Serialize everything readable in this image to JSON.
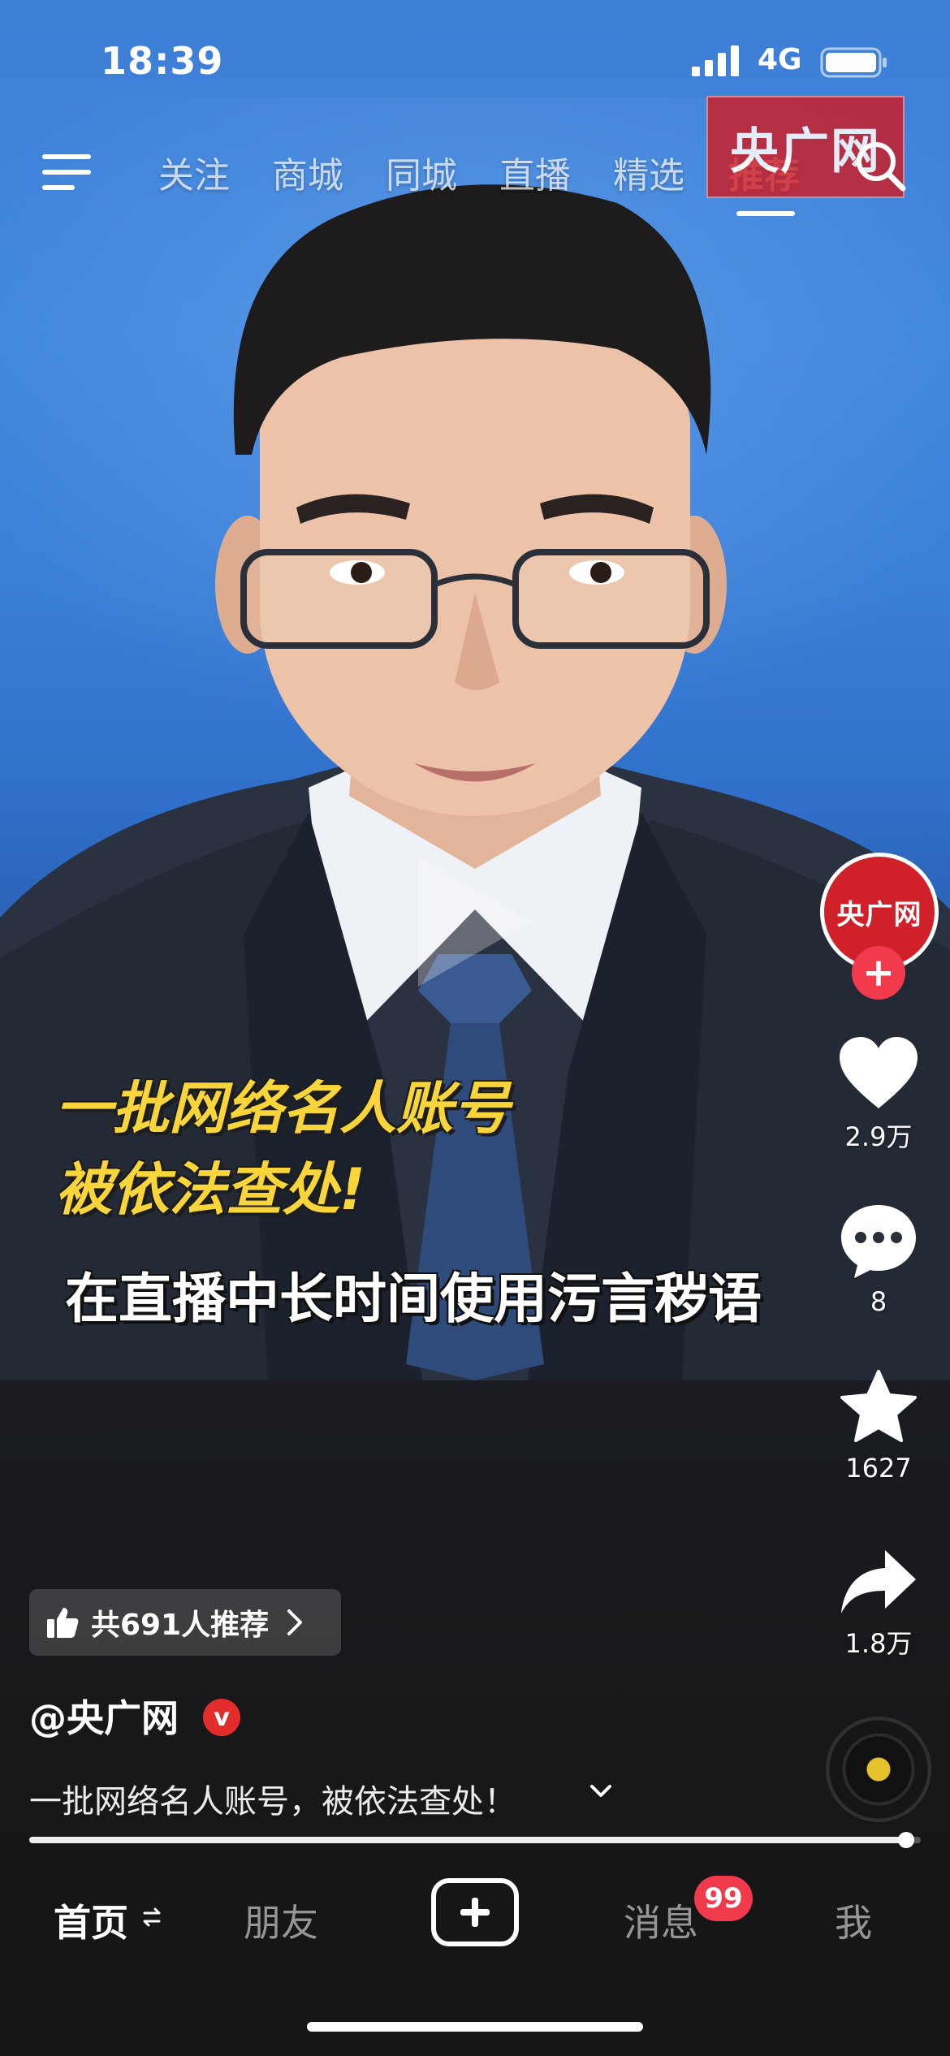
{
  "status_bar": {
    "time": "18:39",
    "network": "4G",
    "icons": [
      "signal-icon",
      "battery-icon"
    ]
  },
  "top_nav": {
    "tabs": [
      {
        "label": "关注"
      },
      {
        "label": "商城"
      },
      {
        "label": "同城"
      },
      {
        "label": "直播"
      },
      {
        "label": "精选"
      },
      {
        "label": "推荐",
        "active": true
      }
    ],
    "icons": [
      "menu-icon",
      "search-icon"
    ]
  },
  "video": {
    "watermark": "央广网",
    "caption_headline": [
      "一批网络名人账号",
      "被依法查处!"
    ],
    "caption_subtitle": "在直播中长时间使用污言秽语"
  },
  "right_rail": {
    "avatar_text": "央广网",
    "follow": "+",
    "likes": "2.9万",
    "comments": "8",
    "favorites": "1627",
    "shares": "1.8万"
  },
  "info": {
    "recommend": "共691人推荐",
    "author": "@央广网",
    "verified": "v",
    "description": "一批网络名人账号，被依法查处！"
  },
  "progress": {
    "fraction": 0.984
  },
  "tab_bar": {
    "home": "首页",
    "friends": "朋友",
    "create": "+",
    "messages": "消息",
    "messages_badge": "99",
    "me": "我"
  },
  "colors": {
    "accent_red": "#f23a4d",
    "caption_yellow": "#f7d53b",
    "watermark_red": "#c8202a",
    "studio_blue": "#3e7fd6"
  }
}
